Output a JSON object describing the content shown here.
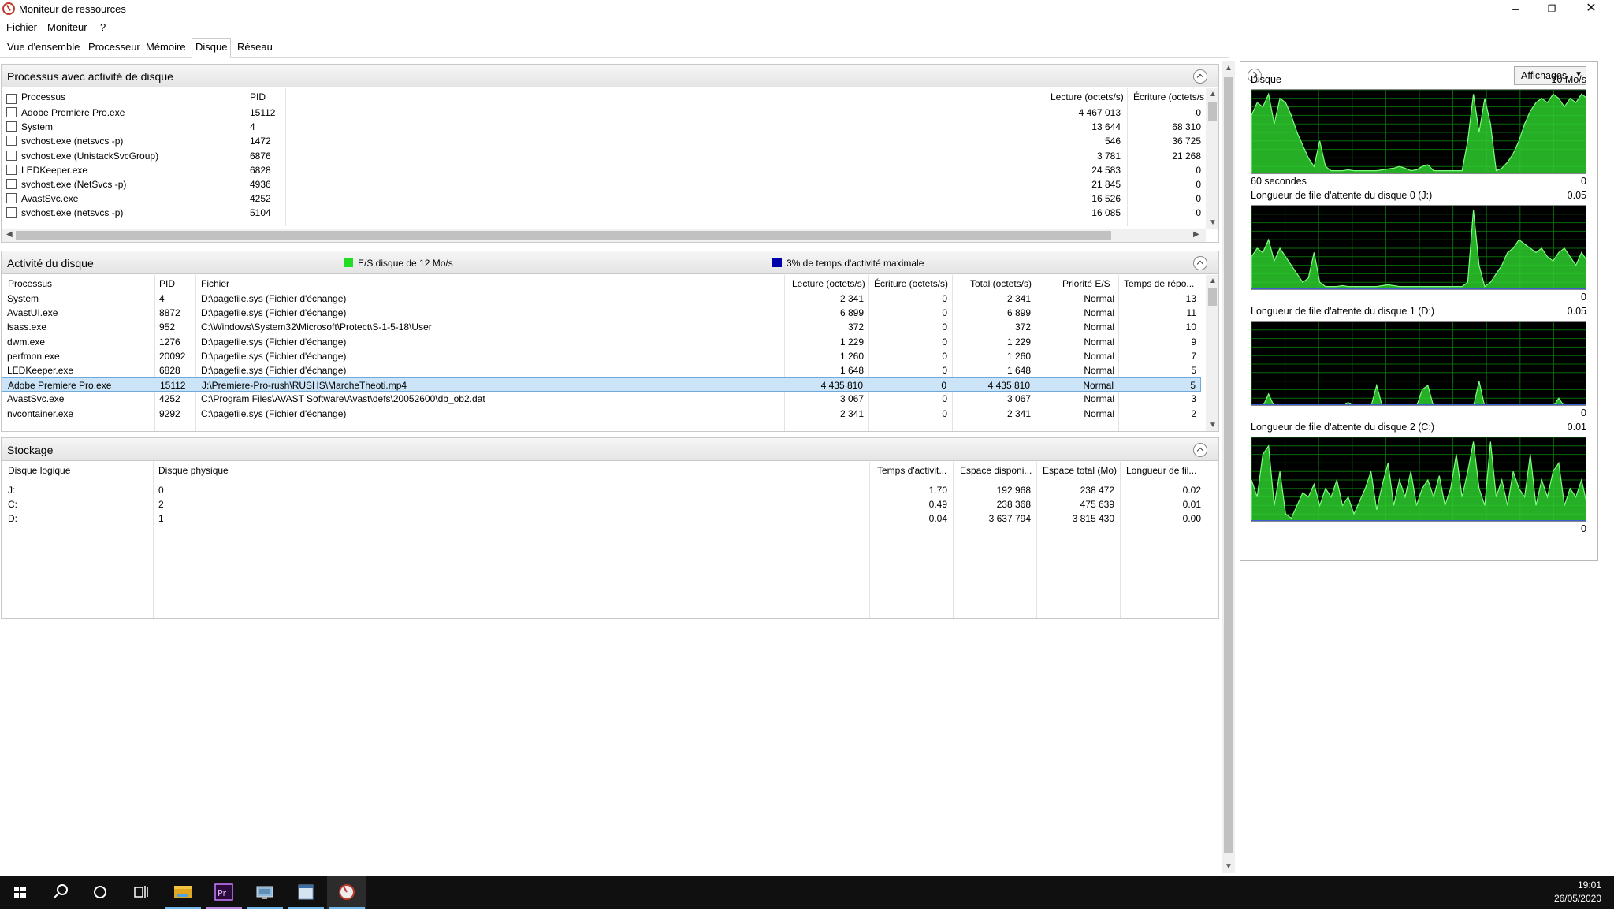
{
  "window": {
    "title": "Moniteur de ressources"
  },
  "menu": [
    "Fichier",
    "Moniteur",
    "?"
  ],
  "tabs": [
    "Vue d'ensemble",
    "Processeur",
    "Mémoire",
    "Disque",
    "Réseau"
  ],
  "active_tab": "Disque",
  "disk_processes": {
    "title": "Processus avec activité de disque",
    "headers": {
      "process": "Processus",
      "pid": "PID",
      "read": "Lecture (octets/s)",
      "write": "Écriture (octets/s"
    },
    "rows": [
      {
        "name": "Adobe Premiere Pro.exe",
        "pid": "15112",
        "read": "4 467 013",
        "write": "0"
      },
      {
        "name": "System",
        "pid": "4",
        "read": "13 644",
        "write": "68 310"
      },
      {
        "name": "svchost.exe (netsvcs -p)",
        "pid": "1472",
        "read": "546",
        "write": "36 725"
      },
      {
        "name": "svchost.exe (UnistackSvcGroup)",
        "pid": "6876",
        "read": "3 781",
        "write": "21 268"
      },
      {
        "name": "LEDKeeper.exe",
        "pid": "6828",
        "read": "24 583",
        "write": "0"
      },
      {
        "name": "svchost.exe (NetSvcs -p)",
        "pid": "4936",
        "read": "21 845",
        "write": "0"
      },
      {
        "name": "AvastSvc.exe",
        "pid": "4252",
        "read": "16 526",
        "write": "0"
      },
      {
        "name": "svchost.exe (netsvcs -p)",
        "pid": "5104",
        "read": "16 085",
        "write": "0"
      }
    ]
  },
  "disk_activity": {
    "title": "Activité du disque",
    "legend_io": "E/S disque de 12 Mo/s",
    "legend_active": "3% de temps d'activité maximale",
    "legend_io_color": "#22dd22",
    "legend_active_color": "#0000aa",
    "headers": {
      "process": "Processus",
      "pid": "PID",
      "file": "Fichier",
      "read": "Lecture (octets/s)",
      "write": "Écriture (octets/s)",
      "total": "Total (octets/s)",
      "priority": "Priorité E/S",
      "response": "Temps de répo..."
    },
    "rows": [
      {
        "name": "System",
        "pid": "4",
        "file": "D:\\pagefile.sys (Fichier d'échange)",
        "read": "2 341",
        "write": "0",
        "total": "2 341",
        "priority": "Normal",
        "response": "13"
      },
      {
        "name": "AvastUI.exe",
        "pid": "8872",
        "file": "D:\\pagefile.sys (Fichier d'échange)",
        "read": "6 899",
        "write": "0",
        "total": "6 899",
        "priority": "Normal",
        "response": "11"
      },
      {
        "name": "lsass.exe",
        "pid": "952",
        "file": "C:\\Windows\\System32\\Microsoft\\Protect\\S-1-5-18\\User",
        "read": "372",
        "write": "0",
        "total": "372",
        "priority": "Normal",
        "response": "10"
      },
      {
        "name": "dwm.exe",
        "pid": "1276",
        "file": "D:\\pagefile.sys (Fichier d'échange)",
        "read": "1 229",
        "write": "0",
        "total": "1 229",
        "priority": "Normal",
        "response": "9"
      },
      {
        "name": "perfmon.exe",
        "pid": "20092",
        "file": "D:\\pagefile.sys (Fichier d'échange)",
        "read": "1 260",
        "write": "0",
        "total": "1 260",
        "priority": "Normal",
        "response": "7"
      },
      {
        "name": "LEDKeeper.exe",
        "pid": "6828",
        "file": "D:\\pagefile.sys (Fichier d'échange)",
        "read": "1 648",
        "write": "0",
        "total": "1 648",
        "priority": "Normal",
        "response": "5"
      },
      {
        "name": "Adobe Premiere Pro.exe",
        "pid": "15112",
        "file": "J:\\Premiere-Pro-rush\\RUSHS\\MarcheTheoti.mp4",
        "read": "4 435 810",
        "write": "0",
        "total": "4 435 810",
        "priority": "Normal",
        "response": "5",
        "selected": true
      },
      {
        "name": "AvastSvc.exe",
        "pid": "4252",
        "file": "C:\\Program Files\\AVAST Software\\Avast\\defs\\20052600\\db_ob2.dat",
        "read": "3 067",
        "write": "0",
        "total": "3 067",
        "priority": "Normal",
        "response": "3"
      },
      {
        "name": "nvcontainer.exe",
        "pid": "9292",
        "file": "C:\\pagefile.sys (Fichier d'échange)",
        "read": "2 341",
        "write": "0",
        "total": "2 341",
        "priority": "Normal",
        "response": "2"
      }
    ]
  },
  "storage": {
    "title": "Stockage",
    "headers": {
      "logical": "Disque logique",
      "physical": "Disque physique",
      "active_time": "Temps d'activit...",
      "free": "Espace disponi...",
      "total": "Espace total (Mo)",
      "queue": "Longueur de fil..."
    },
    "rows": [
      {
        "logical": "J:",
        "physical": "0",
        "active_time": "1.70",
        "free": "192 968",
        "total": "238 472",
        "queue": "0.02"
      },
      {
        "logical": "C:",
        "physical": "2",
        "active_time": "0.49",
        "free": "238 368",
        "total": "475 639",
        "queue": "0.01"
      },
      {
        "logical": "D:",
        "physical": "1",
        "active_time": "0.04",
        "free": "3 637 794",
        "total": "3 815 430",
        "queue": "0.00"
      }
    ]
  },
  "right_pane": {
    "views_button": "Affichages",
    "graphs": [
      {
        "title": "Disque",
        "max": "10 Mo/s",
        "bottom_left": "60 secondes",
        "min": "0",
        "values": [
          0.7,
          0.85,
          0.8,
          0.95,
          0.6,
          0.9,
          0.85,
          0.7,
          0.5,
          0.35,
          0.2,
          0.1,
          0.4,
          0.1,
          0.05,
          0.05,
          0.05,
          0.06,
          0.05,
          0.05,
          0.05,
          0.05,
          0.05,
          0.06,
          0.07,
          0.08,
          0.1,
          0.08,
          0.05,
          0.06,
          0.1,
          0.12,
          0.05,
          0.05,
          0.05,
          0.05,
          0.05,
          0.05,
          0.4,
          0.95,
          0.5,
          0.9,
          0.6,
          0.05,
          0.08,
          0.15,
          0.25,
          0.4,
          0.6,
          0.75,
          0.85,
          0.9,
          0.85,
          0.95,
          0.9,
          0.8,
          0.9,
          0.85,
          0.95,
          0.9
        ]
      },
      {
        "title": "Longueur de file d'attente du disque 0 (J:)",
        "max": "0.05",
        "min": "0",
        "values": [
          0.4,
          0.5,
          0.45,
          0.6,
          0.35,
          0.5,
          0.4,
          0.3,
          0.2,
          0.1,
          0.15,
          0.45,
          0.1,
          0.05,
          0.05,
          0.05,
          0.06,
          0.05,
          0.05,
          0.05,
          0.05,
          0.05,
          0.05,
          0.06,
          0.07,
          0.06,
          0.05,
          0.05,
          0.05,
          0.05,
          0.05,
          0.05,
          0.05,
          0.05,
          0.05,
          0.05,
          0.05,
          0.05,
          0.1,
          0.95,
          0.3,
          0.05,
          0.1,
          0.2,
          0.3,
          0.45,
          0.5,
          0.6,
          0.55,
          0.5,
          0.45,
          0.5,
          0.4,
          0.35,
          0.45,
          0.5,
          0.4,
          0.3,
          0.45,
          0.35
        ]
      },
      {
        "title": "Longueur de file d'attente du disque 1 (D:)",
        "max": "0.05",
        "min": "0",
        "values": [
          0,
          0,
          0,
          0.15,
          0,
          0,
          0,
          0,
          0,
          0,
          0,
          0,
          0,
          0,
          0,
          0,
          0,
          0.05,
          0,
          0,
          0,
          0,
          0.25,
          0,
          0,
          0,
          0,
          0,
          0,
          0,
          0.2,
          0.25,
          0,
          0,
          0,
          0,
          0,
          0,
          0,
          0,
          0.3,
          0,
          0,
          0,
          0,
          0,
          0,
          0,
          0,
          0,
          0,
          0,
          0,
          0,
          0.1,
          0,
          0,
          0,
          0,
          0
        ]
      },
      {
        "title": "Longueur de file d'attente du disque 2 (C:)",
        "max": "0.01",
        "min": "0",
        "values": [
          0.5,
          0.3,
          0.8,
          0.9,
          0.2,
          0.6,
          0.1,
          0.05,
          0.2,
          0.35,
          0.3,
          0.45,
          0.2,
          0.4,
          0.3,
          0.5,
          0.2,
          0.3,
          0.1,
          0.25,
          0.4,
          0.6,
          0.15,
          0.45,
          0.7,
          0.2,
          0.5,
          0.3,
          0.6,
          0.2,
          0.4,
          0.5,
          0.3,
          0.55,
          0.2,
          0.4,
          0.8,
          0.3,
          0.6,
          0.95,
          0.4,
          0.2,
          0.95,
          0.3,
          0.5,
          0.2,
          0.6,
          0.4,
          0.3,
          0.8,
          0.2,
          0.5,
          0.3,
          0.6,
          0.7,
          0.2,
          0.4,
          0.3,
          0.5,
          0.2
        ]
      }
    ]
  },
  "taskbar": {
    "time": "19:01",
    "date": "26/05/2020"
  }
}
